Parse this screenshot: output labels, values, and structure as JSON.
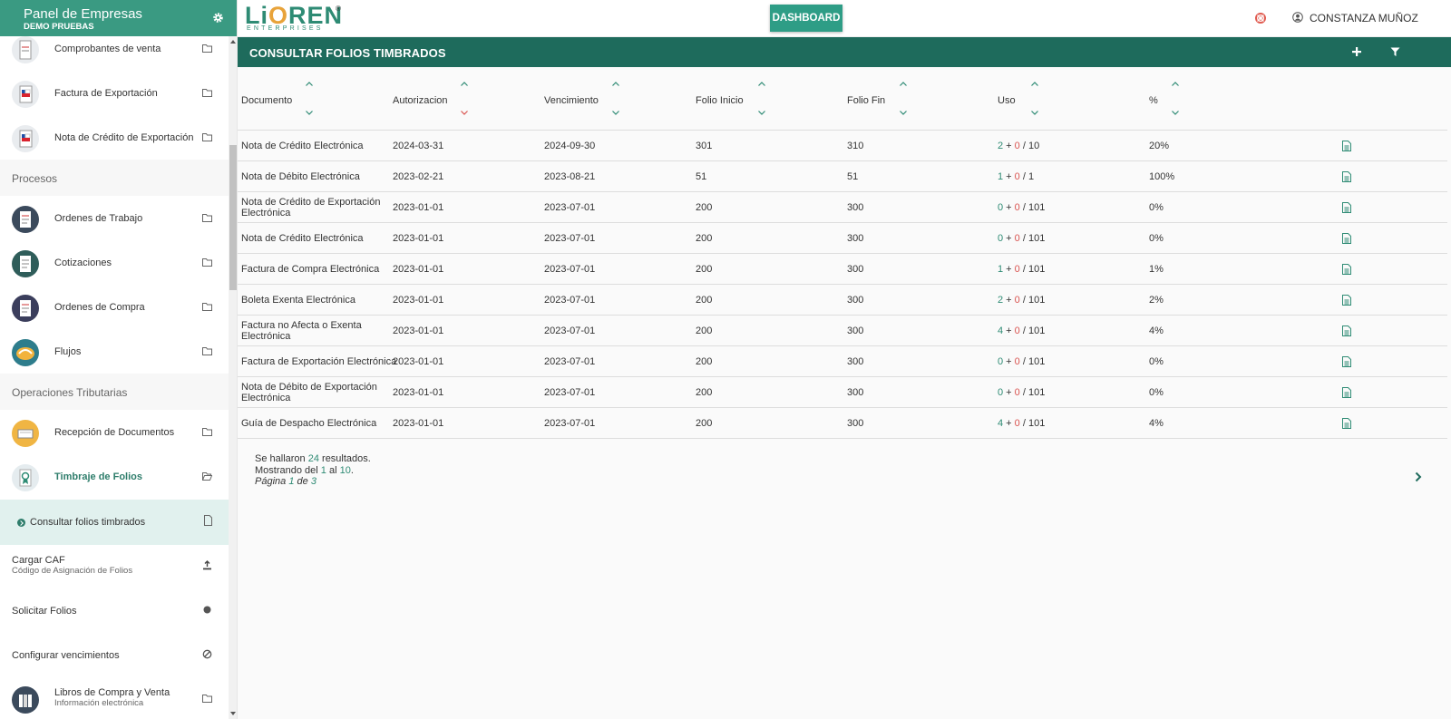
{
  "sidebar": {
    "title": "Panel de Empresas",
    "subtitle": "DEMO PRUEBAS",
    "items_top": [
      {
        "label": "Comprobantes de venta"
      },
      {
        "label": "Factura de Exportación"
      },
      {
        "label": "Nota de Crédito de Exportación"
      }
    ],
    "section_procesos": "Procesos",
    "items_procesos": [
      {
        "label": "Ordenes de Trabajo"
      },
      {
        "label": "Cotizaciones"
      },
      {
        "label": "Ordenes de Compra"
      },
      {
        "label": "Flujos"
      }
    ],
    "section_tributarias": "Operaciones Tributarias",
    "items_tributarias": [
      {
        "label": "Recepción de Documentos"
      },
      {
        "label": "Timbraje de Folios"
      }
    ],
    "sub_active": "Consultar folios timbrados",
    "plain_items": [
      {
        "label": "Cargar CAF",
        "sub": "Código de Asignación de Folios"
      },
      {
        "label": "Solicitar Folios"
      },
      {
        "label": "Configurar vencimientos"
      }
    ],
    "libros": {
      "label": "Libros de Compra y Venta",
      "sub": "Información electrónica"
    }
  },
  "topbar": {
    "logo_main": "LiOREN",
    "logo_sub": "ENTERPRISES",
    "logo_reg": "®",
    "dashboard": "DASHBOARD",
    "user": "CONSTANZA MUÑOZ"
  },
  "page": {
    "title": "CONSULTAR FOLIOS TIMBRADOS"
  },
  "table": {
    "headers": [
      "Documento",
      "Autorizacion",
      "Vencimiento",
      "Folio Inicio",
      "Folio Fin",
      "Uso",
      "%"
    ],
    "rows": [
      {
        "doc": "Nota de Crédito Electrónica",
        "aut": "2024-03-31",
        "ven": "2024-09-30",
        "ini": "301",
        "fin": "310",
        "u1": "2",
        "u2": "0",
        "u3": "10",
        "pct": "20%"
      },
      {
        "doc": "Nota de Débito Electrónica",
        "aut": "2023-02-21",
        "ven": "2023-08-21",
        "ini": "51",
        "fin": "51",
        "u1": "1",
        "u2": "0",
        "u3": "1",
        "pct": "100%"
      },
      {
        "doc": "Nota de Crédito de Exportación Electrónica",
        "aut": "2023-01-01",
        "ven": "2023-07-01",
        "ini": "200",
        "fin": "300",
        "u1": "0",
        "u2": "0",
        "u3": "101",
        "pct": "0%"
      },
      {
        "doc": "Nota de Crédito Electrónica",
        "aut": "2023-01-01",
        "ven": "2023-07-01",
        "ini": "200",
        "fin": "300",
        "u1": "0",
        "u2": "0",
        "u3": "101",
        "pct": "0%"
      },
      {
        "doc": "Factura de Compra Electrónica",
        "aut": "2023-01-01",
        "ven": "2023-07-01",
        "ini": "200",
        "fin": "300",
        "u1": "1",
        "u2": "0",
        "u3": "101",
        "pct": "1%"
      },
      {
        "doc": "Boleta Exenta Electrónica",
        "aut": "2023-01-01",
        "ven": "2023-07-01",
        "ini": "200",
        "fin": "300",
        "u1": "2",
        "u2": "0",
        "u3": "101",
        "pct": "2%"
      },
      {
        "doc": "Factura no Afecta o Exenta Electrónica",
        "aut": "2023-01-01",
        "ven": "2023-07-01",
        "ini": "200",
        "fin": "300",
        "u1": "4",
        "u2": "0",
        "u3": "101",
        "pct": "4%"
      },
      {
        "doc": "Factura de Exportación Electrónica",
        "aut": "2023-01-01",
        "ven": "2023-07-01",
        "ini": "200",
        "fin": "300",
        "u1": "0",
        "u2": "0",
        "u3": "101",
        "pct": "0%"
      },
      {
        "doc": "Nota de Débito de Exportación Electrónica",
        "aut": "2023-01-01",
        "ven": "2023-07-01",
        "ini": "200",
        "fin": "300",
        "u1": "0",
        "u2": "0",
        "u3": "101",
        "pct": "0%"
      },
      {
        "doc": "Guía de Despacho Electrónica",
        "aut": "2023-01-01",
        "ven": "2023-07-01",
        "ini": "200",
        "fin": "300",
        "u1": "4",
        "u2": "0",
        "u3": "101",
        "pct": "4%"
      }
    ]
  },
  "results": {
    "pre": "Se hallaron",
    "total": "24",
    "post": "resultados.",
    "show_pre": "Mostrando del",
    "from": "1",
    "al": "al",
    "to": "10",
    "dot": ".",
    "page_pre": "Página",
    "page": "1",
    "de": "de",
    "pages": "3"
  },
  "colors": {
    "primary": "#1e6b5c",
    "accent": "#2e9d86",
    "sidebar_header": "#3a9a82",
    "danger": "#d9534f"
  }
}
